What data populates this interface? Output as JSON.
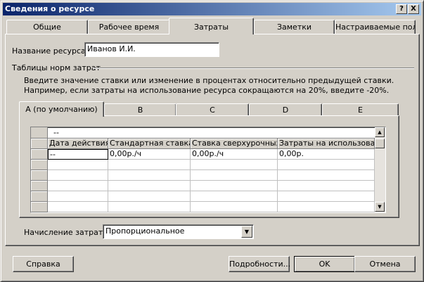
{
  "window": {
    "title": "Сведения о ресурсе",
    "help_btn": "?",
    "close_btn": "X"
  },
  "tabs": [
    {
      "label": "Общие"
    },
    {
      "label": "Рабочее время"
    },
    {
      "label": "Затраты"
    },
    {
      "label": "Заметки"
    },
    {
      "label": "Настраиваемые поля"
    }
  ],
  "resource": {
    "name_label": "Название ресурса:",
    "name_value": "Иванов И.И."
  },
  "rate_tables": {
    "group_label": "Таблицы норм затрат",
    "hint": "Введите значение ставки или изменение в процентах относительно предыдущей ставки. Например, если затраты на использование ресурса сокращаются на 20%, введите -20%.",
    "tabs": [
      {
        "label": "A (по умолчанию)"
      },
      {
        "label": "B"
      },
      {
        "label": "C"
      },
      {
        "label": "D"
      },
      {
        "label": "E"
      }
    ],
    "edit_bar_value": "--",
    "columns": [
      "Дата действия",
      "Стандартная ставка",
      "Ставка сверхурочных",
      "Затраты на использование"
    ],
    "rows": [
      [
        "--",
        "0,00р./ч",
        "0,00р./ч",
        "0,00р."
      ]
    ]
  },
  "accrual": {
    "label": "Начисление затрат:",
    "value": "Пропорциональное"
  },
  "buttons": {
    "help": "Справка",
    "details": "Подробности...",
    "ok": "OK",
    "cancel": "Отмена"
  }
}
